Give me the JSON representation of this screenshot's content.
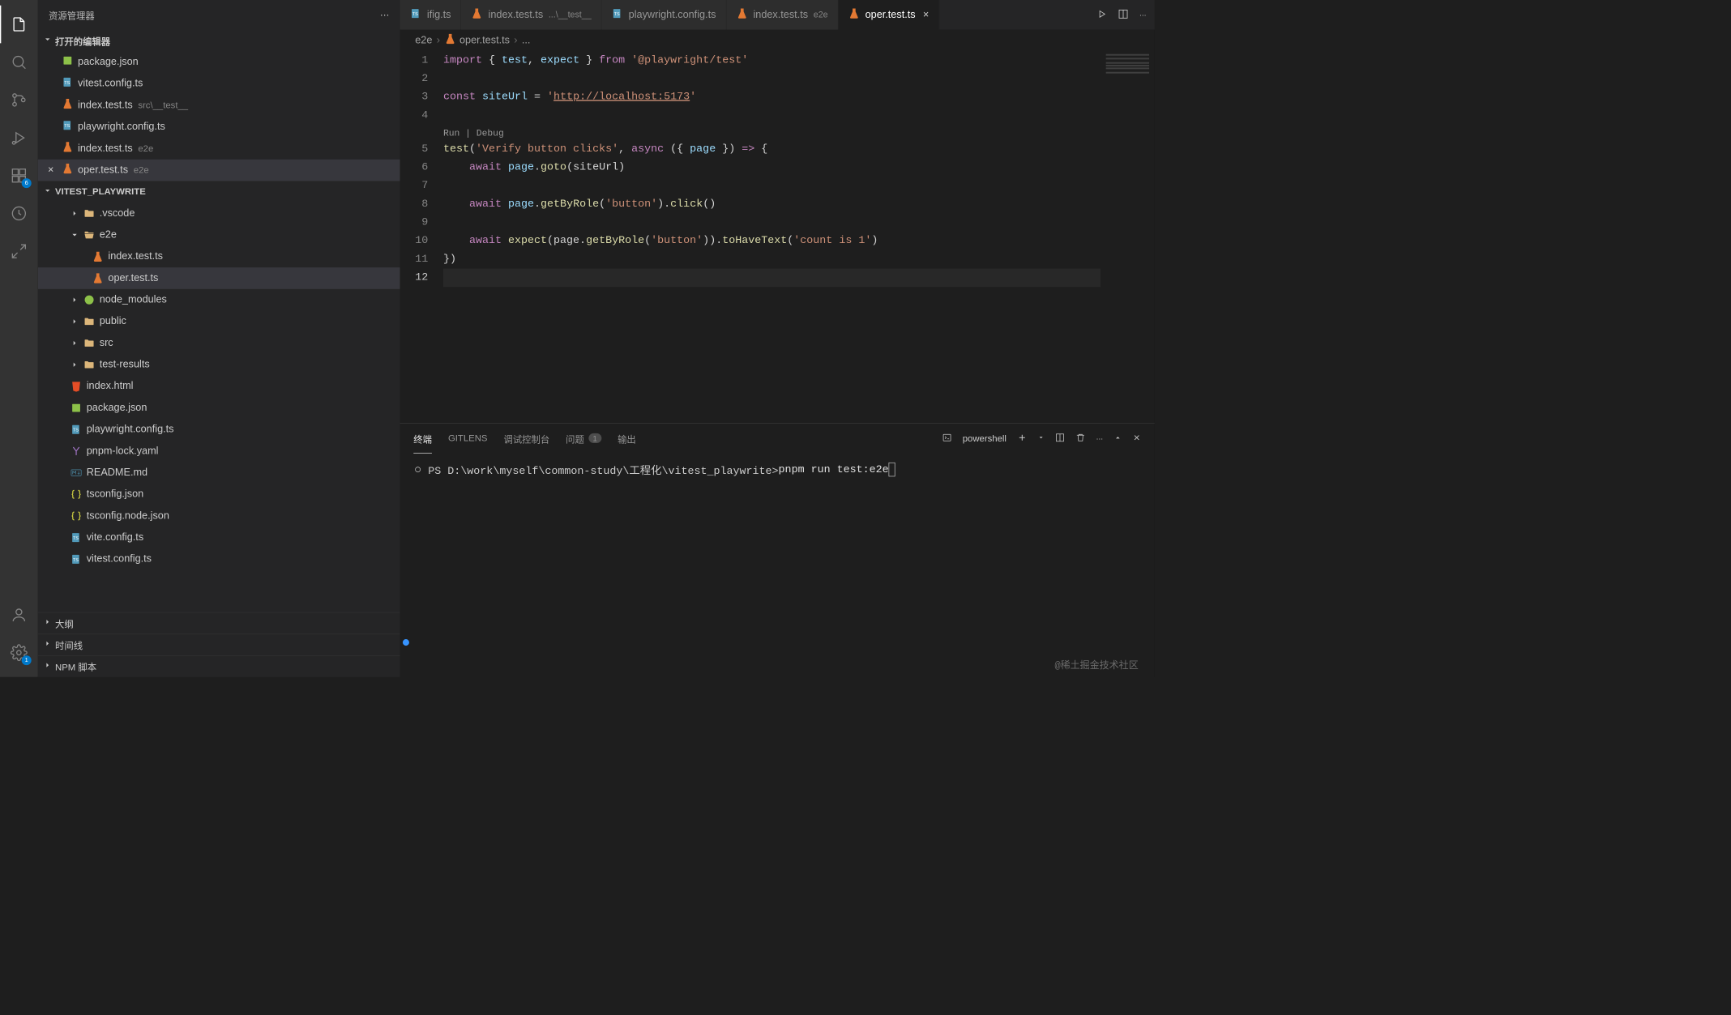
{
  "sidebar": {
    "title": "资源管理器",
    "open_editors_label": "打开的编辑器",
    "open_editors": [
      {
        "name": "package.json",
        "dim": "",
        "icon": "pkg"
      },
      {
        "name": "vitest.config.ts",
        "dim": "",
        "icon": "ts"
      },
      {
        "name": "index.test.ts",
        "dim": "src\\__test__",
        "icon": "test"
      },
      {
        "name": "playwright.config.ts",
        "dim": "",
        "icon": "ts"
      },
      {
        "name": "index.test.ts",
        "dim": "e2e",
        "icon": "test"
      },
      {
        "name": "oper.test.ts",
        "dim": "e2e",
        "icon": "test",
        "active": true
      }
    ],
    "project_name": "VITEST_PLAYWRITE",
    "tree": [
      {
        "name": ".vscode",
        "type": "folder",
        "level": 1,
        "expanded": false
      },
      {
        "name": "e2e",
        "type": "folder",
        "level": 1,
        "expanded": true
      },
      {
        "name": "index.test.ts",
        "type": "file",
        "icon": "test",
        "level": 2
      },
      {
        "name": "oper.test.ts",
        "type": "file",
        "icon": "test",
        "level": 2,
        "selected": true
      },
      {
        "name": "node_modules",
        "type": "folder",
        "icon": "nm",
        "level": 1,
        "expanded": false
      },
      {
        "name": "public",
        "type": "folder",
        "level": 1,
        "expanded": false
      },
      {
        "name": "src",
        "type": "folder",
        "level": 1,
        "expanded": false
      },
      {
        "name": "test-results",
        "type": "folder",
        "level": 1,
        "expanded": false
      },
      {
        "name": "index.html",
        "type": "file",
        "icon": "html",
        "level": 1
      },
      {
        "name": "package.json",
        "type": "file",
        "icon": "pkg",
        "level": 1
      },
      {
        "name": "playwright.config.ts",
        "type": "file",
        "icon": "ts",
        "level": 1
      },
      {
        "name": "pnpm-lock.yaml",
        "type": "file",
        "icon": "yaml",
        "level": 1
      },
      {
        "name": "README.md",
        "type": "file",
        "icon": "md",
        "level": 1
      },
      {
        "name": "tsconfig.json",
        "type": "file",
        "icon": "json",
        "level": 1
      },
      {
        "name": "tsconfig.node.json",
        "type": "file",
        "icon": "json",
        "level": 1
      },
      {
        "name": "vite.config.ts",
        "type": "file",
        "icon": "ts",
        "level": 1
      },
      {
        "name": "vitest.config.ts",
        "type": "file",
        "icon": "ts",
        "level": 1
      }
    ],
    "outline_label": "大纲",
    "timeline_label": "时间线",
    "npm_label": "NPM 脚本"
  },
  "activity": {
    "ext_badge": "6",
    "settings_badge": "1"
  },
  "tabs": [
    {
      "name": "ifig.ts",
      "icon": "ts",
      "partial": true
    },
    {
      "name": "index.test.ts",
      "dim": "...\\__test__",
      "icon": "test"
    },
    {
      "name": "playwright.config.ts",
      "icon": "ts"
    },
    {
      "name": "index.test.ts",
      "dim": "e2e",
      "icon": "test"
    },
    {
      "name": "oper.test.ts",
      "icon": "test",
      "active": true,
      "close": true
    }
  ],
  "breadcrumb": {
    "p1": "e2e",
    "p2": "oper.test.ts",
    "p3": "..."
  },
  "code": {
    "codelens": "Run | Debug",
    "lines": [
      1,
      2,
      3,
      4,
      5,
      6,
      7,
      8,
      9,
      10,
      11,
      12
    ],
    "l1_import": "import",
    "l1_brace1": " { ",
    "l1_test": "test",
    "l1_comma": ", ",
    "l1_expect": "expect",
    "l1_brace2": " } ",
    "l1_from": "from",
    "l1_str": " '@playwright/test'",
    "l3_const": "const",
    "l3_site": " siteUrl ",
    "l3_eq": "= ",
    "l3_q1": "'",
    "l3_url": "http://localhost:5173",
    "l3_q2": "'",
    "l5_test": "test",
    "l5_open": "(",
    "l5_str": "'Verify button clicks'",
    "l5_comma": ", ",
    "l5_async": "async",
    "l5_args": " ({ ",
    "l5_page": "page",
    "l5_args2": " }) ",
    "l5_arrow": "=>",
    "l5_brace": " {",
    "l6_await": "    await",
    "l6_page": " page",
    "l6_dot": ".",
    "l6_goto": "goto",
    "l6_args": "(siteUrl)",
    "l8_await": "    await",
    "l8_page": " page",
    "l8_dot": ".",
    "l8_get": "getByRole",
    "l8_args1": "(",
    "l8_str": "'button'",
    "l8_args2": ").",
    "l8_click": "click",
    "l8_args3": "()",
    "l10_await": "    await",
    "l10_expect": " expect",
    "l10_a1": "(page.",
    "l10_get": "getByRole",
    "l10_a2": "(",
    "l10_str1": "'button'",
    "l10_a3": ")).",
    "l10_have": "toHaveText",
    "l10_a4": "(",
    "l10_str2": "'count is 1'",
    "l10_a5": ")",
    "l11": "})"
  },
  "panel": {
    "tab_terminal": "终端",
    "tab_gitlens": "GITLENS",
    "tab_debug": "调试控制台",
    "tab_problems": "问题",
    "problems_count": "1",
    "tab_output": "输出",
    "shell": "powershell",
    "prompt": "PS D:\\work\\myself\\common-study\\工程化\\vitest_playwrite> ",
    "cmd": "pnpm run test:e2e"
  },
  "watermark": "@稀土掘金技术社区"
}
